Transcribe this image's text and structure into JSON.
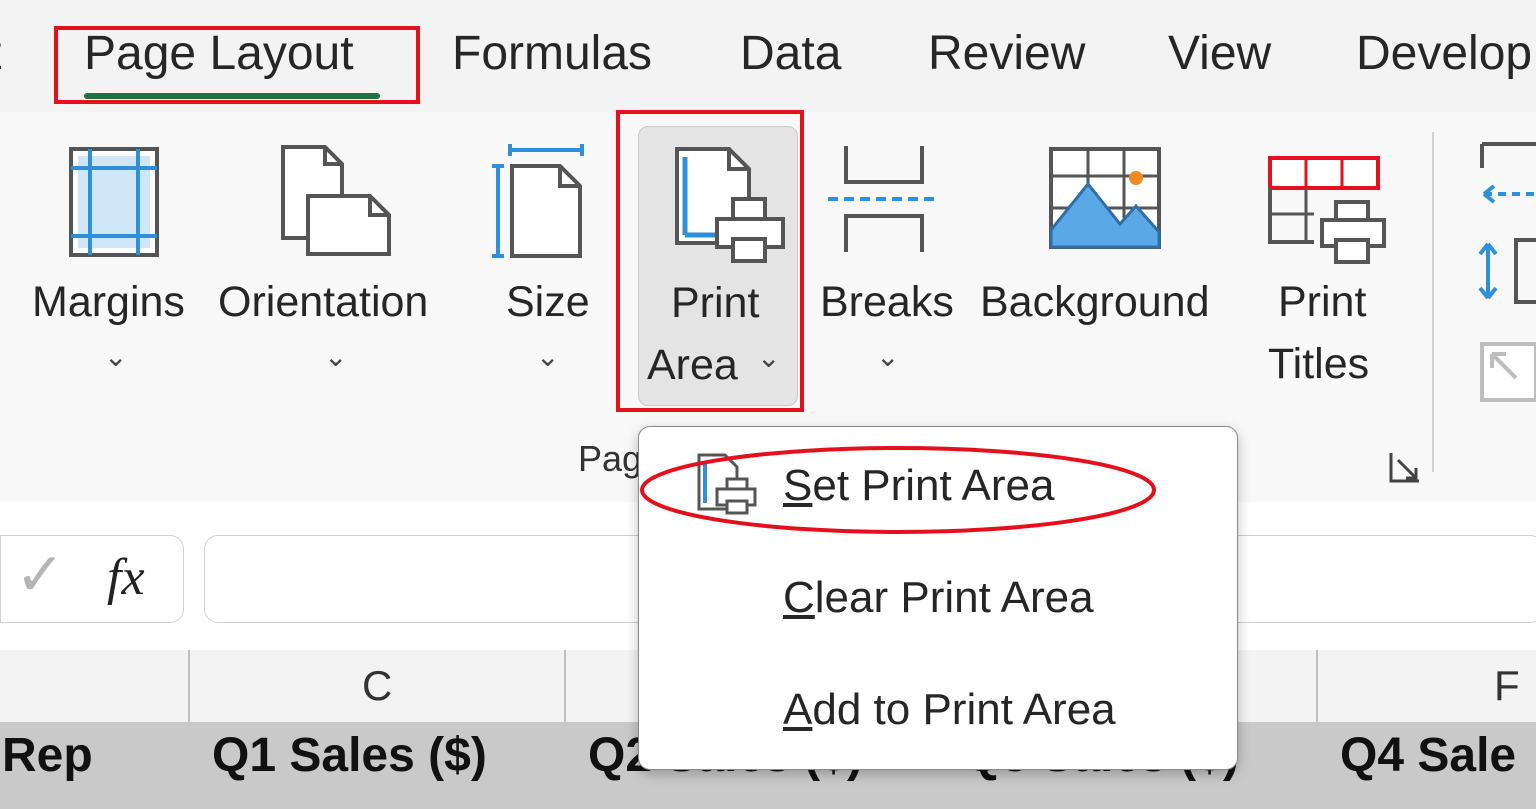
{
  "tabs": [
    {
      "label": "t"
    },
    {
      "label": "Page Layout",
      "active": true
    },
    {
      "label": "Formulas"
    },
    {
      "label": "Data"
    },
    {
      "label": "Review"
    },
    {
      "label": "View"
    },
    {
      "label": "Develop"
    }
  ],
  "ribbon": {
    "margins": "Margins",
    "orientation": "Orientation",
    "size": "Size",
    "print_area_line1": "Print",
    "print_area_line2": "Area",
    "breaks": "Breaks",
    "background": "Background",
    "print_titles_line1": "Print",
    "print_titles_line2": "Titles",
    "group_label_visible": "Pag"
  },
  "icons": {
    "margins": "margins-icon",
    "orientation": "orientation-icon",
    "size": "size-icon",
    "print_area": "print-area-icon",
    "breaks": "breaks-icon",
    "background": "background-icon",
    "print_titles": "print-titles-icon"
  },
  "formula_bar": {
    "enter_symbol": "✓",
    "fx_label": "fx",
    "value": ""
  },
  "dropdown": {
    "items": [
      {
        "label": "Set Print Area",
        "access_key": "S"
      },
      {
        "label": "Clear Print Area",
        "access_key": "C"
      },
      {
        "label": "Add to Print Area",
        "access_key": "A"
      }
    ]
  },
  "grid": {
    "columns": [
      "C",
      "F"
    ],
    "header_cells": [
      "Rep",
      "Q1 Sales ($)",
      "Q2 Sales ($)",
      "Q3 Sales ($)",
      "Q4 Sale"
    ]
  },
  "colors": {
    "highlight": "#e5101b",
    "active_tab_underline": "#1e7145",
    "icon_blue": "#2f8fd8",
    "icon_gray": "#555555"
  }
}
